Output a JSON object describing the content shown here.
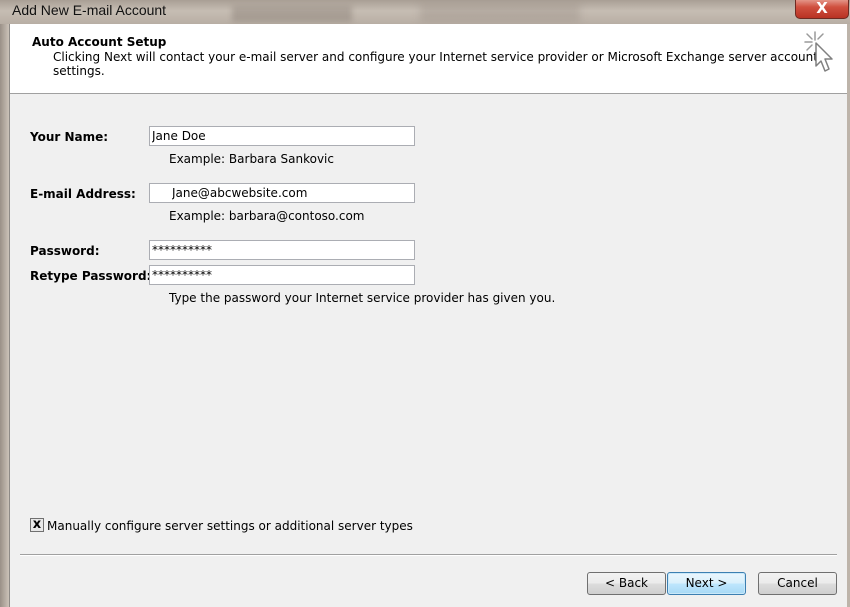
{
  "window": {
    "title": "Add New E-mail Account",
    "close_glyph": "X"
  },
  "header": {
    "title": "Auto Account Setup",
    "description": "Clicking Next will contact your e-mail server and configure your Internet service provider or Microsoft Exchange server account settings.",
    "icon": "wizard-cursor-icon"
  },
  "form": {
    "name": {
      "label": "Your Name:",
      "value": "Jane Doe",
      "example": "Example: Barbara Sankovic"
    },
    "email": {
      "label": "E-mail Address:",
      "value": "Jane@abcwebsite.com",
      "example": "Example: barbara@contoso.com"
    },
    "password": {
      "label": "Password:",
      "value": "**********"
    },
    "retype_password": {
      "label": "Retype Password:",
      "value": "**********"
    },
    "password_hint": "Type the password your Internet service provider has given you."
  },
  "manual_config": {
    "checked": true,
    "check_glyph": "x",
    "label": "Manually configure server settings or additional server types"
  },
  "buttons": {
    "back": "< Back",
    "next": "Next >",
    "cancel": "Cancel"
  }
}
